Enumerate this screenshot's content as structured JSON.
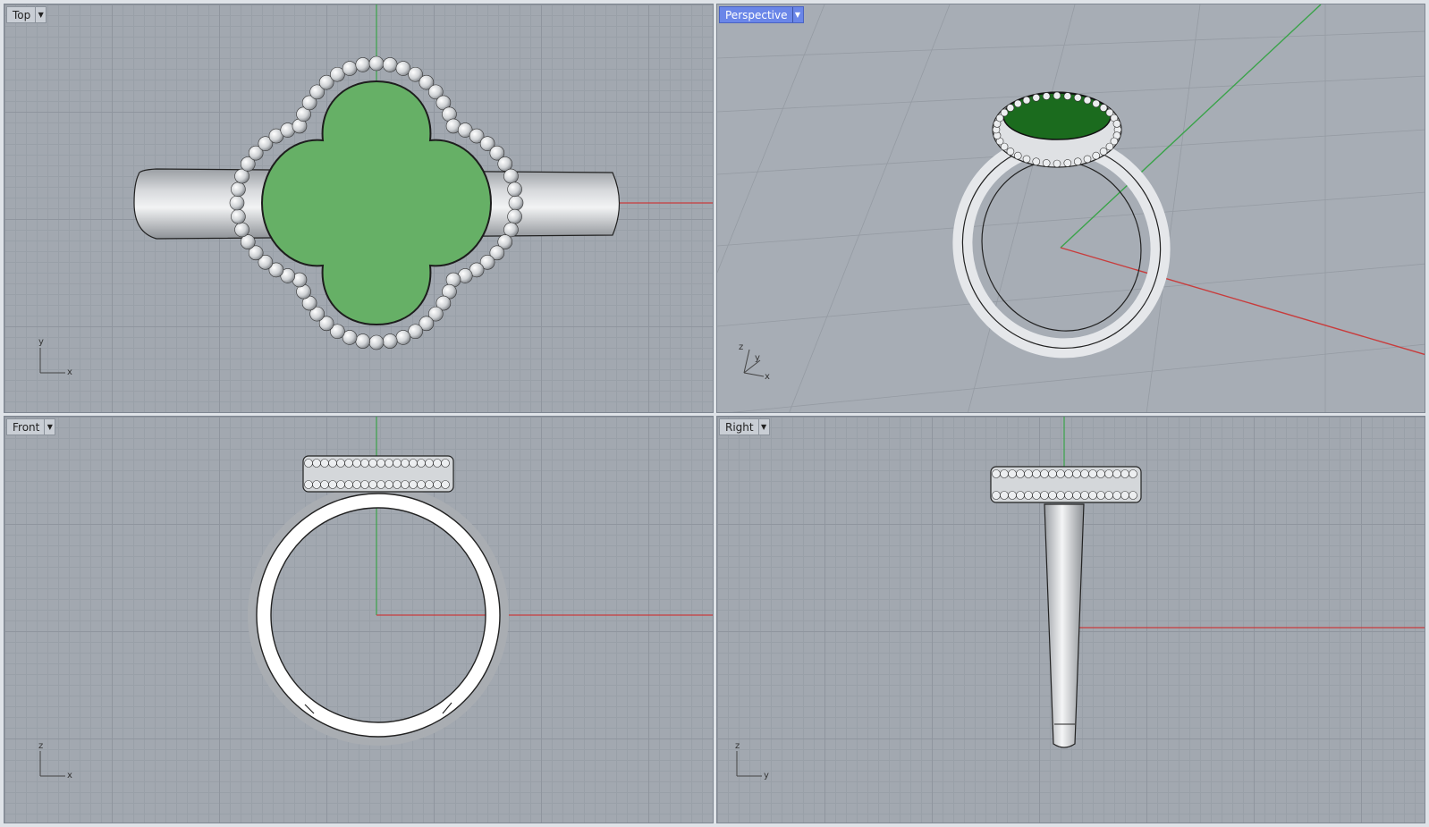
{
  "viewports": {
    "top": {
      "label": "Top",
      "axes": [
        "y",
        "x"
      ]
    },
    "perspective": {
      "label": "Perspective",
      "axes": [
        "z",
        "y",
        "x"
      ]
    },
    "front": {
      "label": "Front",
      "axes": [
        "z",
        "x"
      ]
    },
    "right": {
      "label": "Right",
      "axes": [
        "z",
        "y"
      ]
    }
  },
  "colors": {
    "grid_bg": "#a2a8b0",
    "x_axis": "#c83c3c",
    "y_axis": "#3aa34a",
    "gem_top": "#66b066",
    "gem_persp": "#1b6b1e",
    "metal": "#e4e6e9",
    "active_label": "#6a86e8"
  },
  "icons": {
    "dropdown": "chevron-down-icon"
  }
}
